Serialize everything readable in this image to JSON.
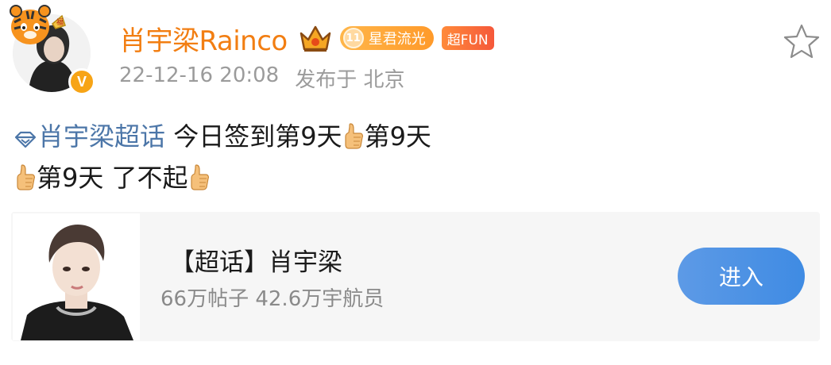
{
  "header": {
    "username": "肖宇梁Rainco",
    "level_badge": {
      "number": "11",
      "label": "星君流光"
    },
    "fun_badge": "超FUN",
    "verified_mark": "V",
    "timestamp": "22-12-16 20:08",
    "location": "发布于 北京"
  },
  "post": {
    "topic_link": "肖宇梁超话",
    "line1_text": "今日签到第9天",
    "line1_tail": "第9天",
    "line2_text": "第9天 了不起"
  },
  "card": {
    "title": "【超话】肖宇梁",
    "stats": "66万帖子 42.6万宇航员",
    "enter_label": "进入"
  },
  "icons": {
    "favorite": "star-outline-icon",
    "topic": "diamond-icon",
    "thumbs": "thumbs-up-emoji"
  },
  "colors": {
    "username": "#f27e12",
    "link": "#4c76a8",
    "meta": "#9b9b9b",
    "button": "#4a90e2"
  }
}
